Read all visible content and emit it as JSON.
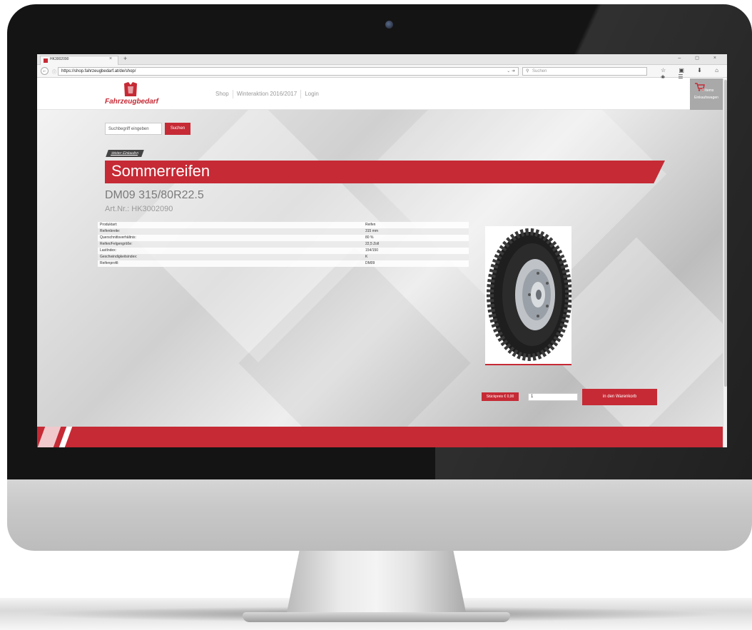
{
  "browser": {
    "tab_title": "HK3002090",
    "tab_close": "×",
    "new_tab": "+",
    "window_controls": "– ◻ ×",
    "url": "https://shop.fahrzeugbedarf.at/de/shop/",
    "url_actions": "⌄ ➜",
    "search_placeholder": "Suchen",
    "search_icon": "search-icon",
    "toolbar_icons": "☆ ▣ ⬇ ⌂ ◈ ☰"
  },
  "site": {
    "logo_text": "Fahrzeugbedarf",
    "nav": [
      "Shop",
      "Winteraktion 2016/2017",
      "Login"
    ],
    "cart": {
      "count_label": "0 Items",
      "label": "Einkaufswagen"
    },
    "search": {
      "placeholder": "Suchbegriff eingeben",
      "button": "Suchen"
    },
    "back_link": "Weiter Einkaufen",
    "category": "Sommerreifen",
    "product": {
      "title": "DM09 315/80R22.5",
      "article_no": "Art.Nr.: HK3002090",
      "specs": [
        {
          "label": "Produktart:",
          "value": "Reifen"
        },
        {
          "label": "Reifenbreite:",
          "value": "315 mm"
        },
        {
          "label": "Querschnittsverhältnis:",
          "value": "80 %"
        },
        {
          "label": "Reifen/Felgengröße:",
          "value": "22,5 Zoll"
        },
        {
          "label": "LastIndex:",
          "value": "154/150"
        },
        {
          "label": "Geschwindigkeitsindex:",
          "value": "K"
        },
        {
          "label": "Reifenprofil:",
          "value": "DM09"
        }
      ],
      "price_label": "Stückpreis € 0,00",
      "quantity": "1",
      "add_to_cart": "in den Warenkorb"
    }
  },
  "colors": {
    "brand_red": "#c62a35",
    "cart_gray": "#a9a9a9"
  }
}
